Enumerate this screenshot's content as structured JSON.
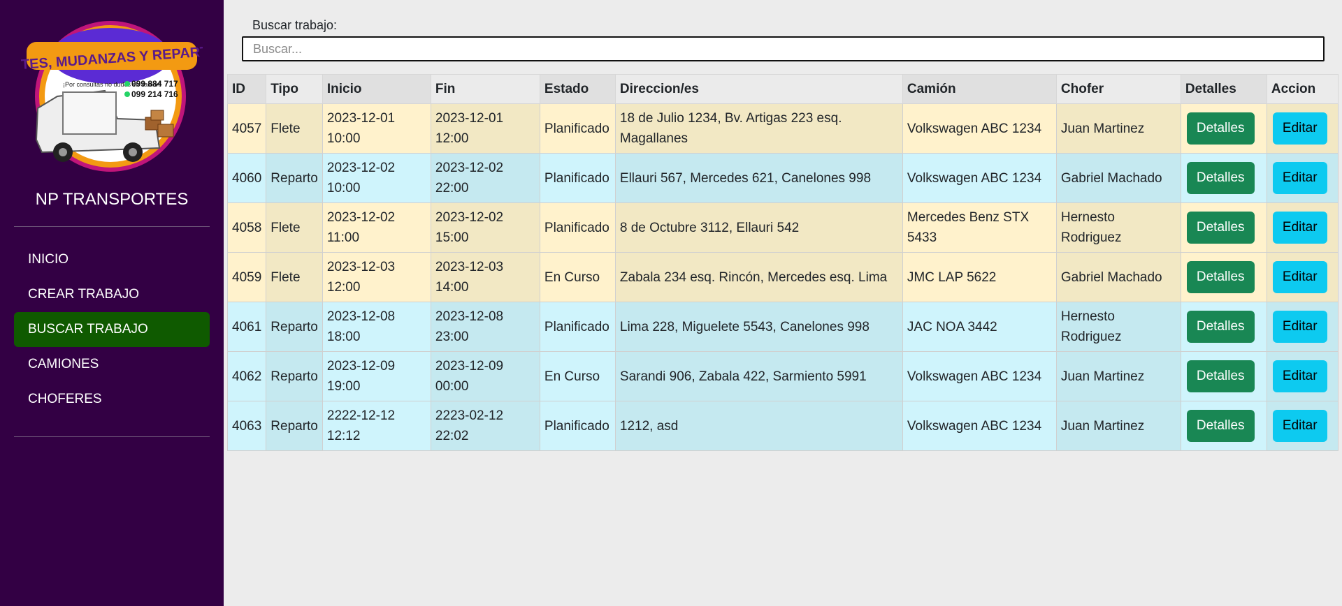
{
  "brand": {
    "name": "NP TRANSPORTES",
    "logo_text": "FLETES, MUDANZAS Y REPARTOS",
    "logo_tagline": "¡Por consultas no dudes en llamar!",
    "logo_phone1": "099 884 717",
    "logo_phone2": "099 214 716"
  },
  "nav": [
    {
      "label": "INICIO",
      "active": false
    },
    {
      "label": "CREAR TRABAJO",
      "active": false
    },
    {
      "label": "BUSCAR TRABAJO",
      "active": true
    },
    {
      "label": "CAMIONES",
      "active": false
    },
    {
      "label": "CHOFERES",
      "active": false
    }
  ],
  "search": {
    "label": "Buscar trabajo:",
    "placeholder": "Buscar...",
    "value": ""
  },
  "table": {
    "columns": [
      "ID",
      "Tipo",
      "Inicio",
      "Fin",
      "Estado",
      "Direccion/es",
      "Camión",
      "Chofer",
      "Detalles",
      "Accion"
    ],
    "rows": [
      {
        "id": "4057",
        "tipo": "Flete",
        "inicio": "2023-12-01 10:00",
        "fin": "2023-12-01 12:00",
        "estado": "Planificado",
        "direcciones": "18 de Julio 1234, Bv. Artigas 223 esq. Magallanes",
        "camion": "Volkswagen ABC 1234",
        "chofer": "Juan Martinez",
        "detalles": "Detalles",
        "accion": "Editar"
      },
      {
        "id": "4060",
        "tipo": "Reparto",
        "inicio": "2023-12-02 10:00",
        "fin": "2023-12-02 22:00",
        "estado": "Planificado",
        "direcciones": "Ellauri 567, Mercedes 621, Canelones 998",
        "camion": "Volkswagen ABC 1234",
        "chofer": "Gabriel Machado",
        "detalles": "Detalles",
        "accion": "Editar"
      },
      {
        "id": "4058",
        "tipo": "Flete",
        "inicio": "2023-12-02 11:00",
        "fin": "2023-12-02 15:00",
        "estado": "Planificado",
        "direcciones": "8 de Octubre 3112, Ellauri 542",
        "camion": "Mercedes Benz STX 5433",
        "chofer": "Hernesto Rodriguez",
        "detalles": "Detalles",
        "accion": "Editar"
      },
      {
        "id": "4059",
        "tipo": "Flete",
        "inicio": "2023-12-03 12:00",
        "fin": "2023-12-03 14:00",
        "estado": "En Curso",
        "direcciones": "Zabala 234 esq. Rincón, Mercedes esq. Lima",
        "camion": "JMC LAP 5622",
        "chofer": "Gabriel Machado",
        "detalles": "Detalles",
        "accion": "Editar"
      },
      {
        "id": "4061",
        "tipo": "Reparto",
        "inicio": "2023-12-08 18:00",
        "fin": "2023-12-08 23:00",
        "estado": "Planificado",
        "direcciones": "Lima 228, Miguelete 5543, Canelones 998",
        "camion": "JAC NOA 3442",
        "chofer": "Hernesto Rodriguez",
        "detalles": "Detalles",
        "accion": "Editar"
      },
      {
        "id": "4062",
        "tipo": "Reparto",
        "inicio": "2023-12-09 19:00",
        "fin": "2023-12-09 00:00",
        "estado": "En Curso",
        "direcciones": "Sarandi 906, Zabala 422, Sarmiento 5991",
        "camion": "Volkswagen ABC 1234",
        "chofer": "Juan Martinez",
        "detalles": "Detalles",
        "accion": "Editar"
      },
      {
        "id": "4063",
        "tipo": "Reparto",
        "inicio": "2222-12-12 12:12",
        "fin": "2223-02-12 22:02",
        "estado": "Planificado",
        "direcciones": "1212, asd",
        "camion": "Volkswagen ABC 1234",
        "chofer": "Juan Martinez",
        "detalles": "Detalles",
        "accion": "Editar"
      }
    ]
  },
  "colors": {
    "sidebar": "#330044",
    "nav_active": "#0f5a00",
    "flete_row": "#fff2cc",
    "reparto_row": "#cff4fc",
    "detalles_button": "#198754",
    "editar_button": "#0dcaf0"
  }
}
